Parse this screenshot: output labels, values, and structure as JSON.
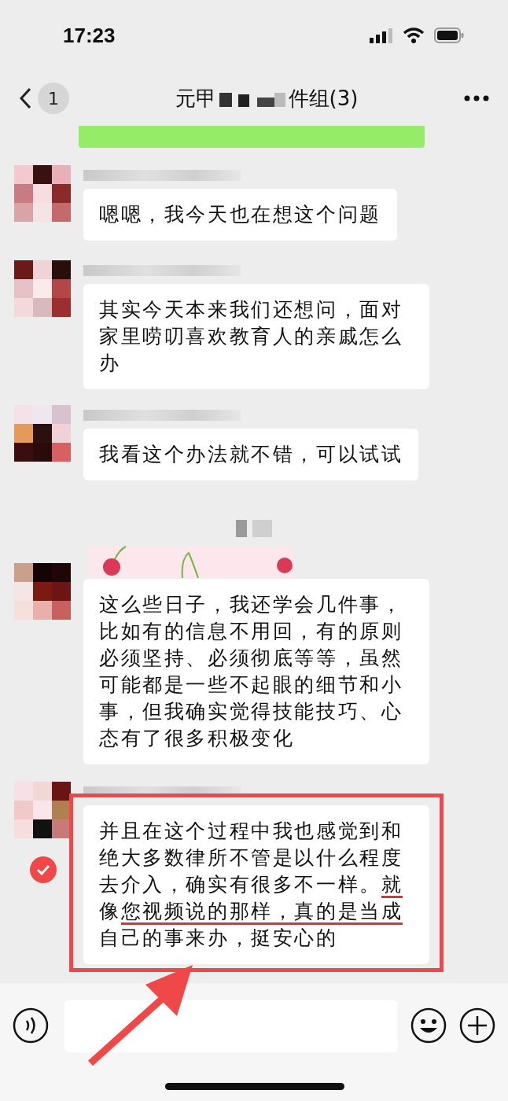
{
  "status_bar": {
    "time": "17:23"
  },
  "header": {
    "back_badge": "1",
    "title_start": "元甲",
    "title_end": "件组(3)"
  },
  "messages": [
    {
      "kind": "text",
      "selected": false,
      "highlighted": false,
      "segments": [
        {
          "text": "嗯嗯，我今天也在想这个问题",
          "underlined": false
        }
      ]
    },
    {
      "kind": "text",
      "selected": false,
      "highlighted": false,
      "segments": [
        {
          "text": "其实今天本来我们还想问，面对家里唠叨喜欢教育人的亲戚怎么办",
          "underlined": false
        }
      ]
    },
    {
      "kind": "text",
      "selected": false,
      "highlighted": false,
      "segments": [
        {
          "text": "我看这个办法就不错，可以试试",
          "underlined": false
        }
      ]
    },
    {
      "kind": "time"
    },
    {
      "kind": "text",
      "selected": false,
      "highlighted": false,
      "segments": [
        {
          "text": "这么些日子，我还学会几件事，比如有的信息不用回，有的原则必须坚持、必须彻底等等，虽然可能都是一些不起眼的细节和小事，但我确实觉得技能技巧、心态有了很多积极变化",
          "underlined": false
        }
      ]
    },
    {
      "kind": "text",
      "selected": true,
      "highlighted": true,
      "segments": [
        {
          "text": "并且在这个过程中我也感觉到和绝大多数律所不管是以什么程度去介入，确实有很多不一样。",
          "underlined": false
        },
        {
          "text": "就",
          "underlined": true
        },
        {
          "text": "像",
          "underlined": false
        },
        {
          "text": "您视频说的那样，",
          "underlined": true
        },
        {
          "text": "真的是当成",
          "underlined": true
        },
        {
          "text": "自己的事来办，挺安心的",
          "underlined": false
        }
      ]
    }
  ]
}
